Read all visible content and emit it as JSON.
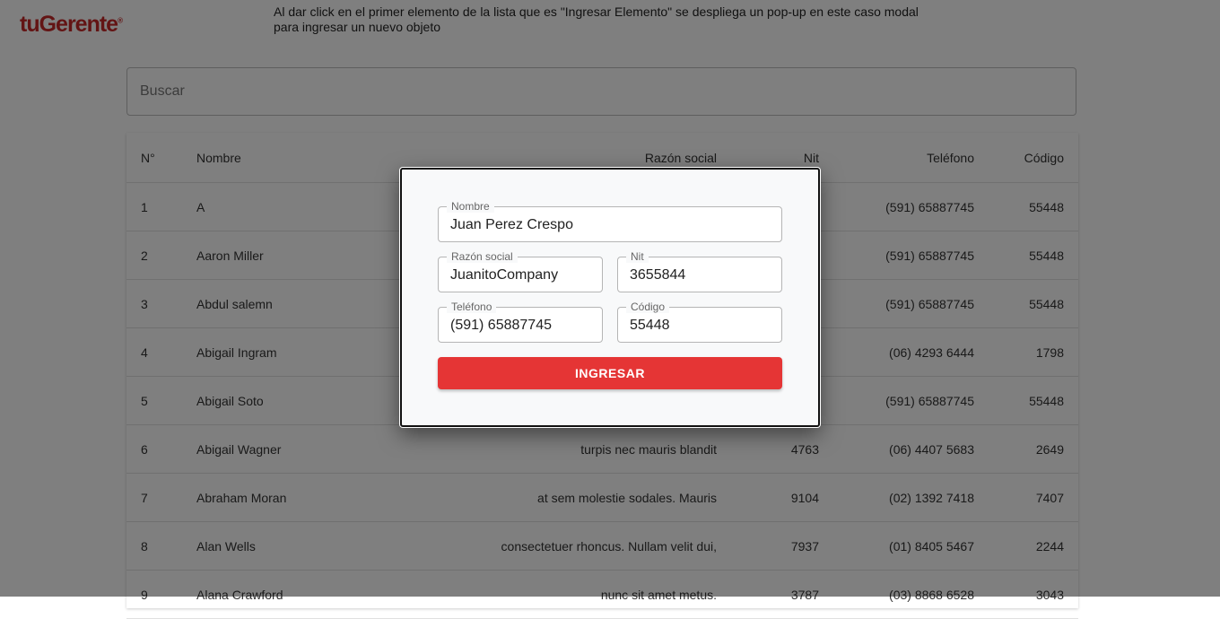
{
  "logo": {
    "text": "tuGerente",
    "mark": "®",
    "color": "#c62828"
  },
  "instruction_note": "Al dar click en el primer elemento de la lista que es \"Ingresar Elemento\" se despliega un pop-up en este caso modal para ingresar un nuevo objeto",
  "search": {
    "placeholder": "Buscar",
    "value": ""
  },
  "table": {
    "headers": {
      "n": "N°",
      "nombre": "Nombre",
      "razon": "Razón social",
      "nit": "Nit",
      "tel": "Teléfono",
      "cod": "Código"
    },
    "rows": [
      {
        "n": "1",
        "nombre": "A",
        "razon": "",
        "nit": "",
        "tel": "(591) 65887745",
        "cod": "55448"
      },
      {
        "n": "2",
        "nombre": "Aaron Miller",
        "razon": "",
        "nit": "",
        "tel": "(591) 65887745",
        "cod": "55448"
      },
      {
        "n": "3",
        "nombre": "Abdul salemn",
        "razon": "",
        "nit": "",
        "tel": "(591) 65887745",
        "cod": "55448"
      },
      {
        "n": "4",
        "nombre": "Abigail Ingram",
        "razon": "",
        "nit": "",
        "tel": "(06) 4293 6444",
        "cod": "1798"
      },
      {
        "n": "5",
        "nombre": "Abigail Soto",
        "razon": "",
        "nit": "",
        "tel": "(591) 65887745",
        "cod": "55448"
      },
      {
        "n": "6",
        "nombre": "Abigail Wagner",
        "razon": "turpis nec mauris blandit",
        "nit": "4763",
        "tel": "(06) 4407 5683",
        "cod": "2649"
      },
      {
        "n": "7",
        "nombre": "Abraham Moran",
        "razon": "at sem molestie sodales. Mauris",
        "nit": "9104",
        "tel": "(02) 1392 7418",
        "cod": "7407"
      },
      {
        "n": "8",
        "nombre": "Alan Wells",
        "razon": "consectetuer rhoncus. Nullam velit dui,",
        "nit": "7937",
        "tel": "(01) 8405 5467",
        "cod": "2244"
      },
      {
        "n": "9",
        "nombre": "Alana Crawford",
        "razon": "nunc sit amet metus.",
        "nit": "3787",
        "tel": "(03) 8868 6528",
        "cod": "3043"
      }
    ]
  },
  "modal": {
    "nombre": {
      "label": "Nombre",
      "value": "Juan Perez Crespo"
    },
    "razon": {
      "label": "Razón social",
      "value": "JuanitoCompany"
    },
    "nit": {
      "label": "Nit",
      "value": "3655844"
    },
    "tel": {
      "label": "Teléfono",
      "value": "(591) 65887745"
    },
    "cod": {
      "label": "Código",
      "value": "55448"
    },
    "submit_label": "INGRESAR",
    "accent": "#e53535"
  }
}
